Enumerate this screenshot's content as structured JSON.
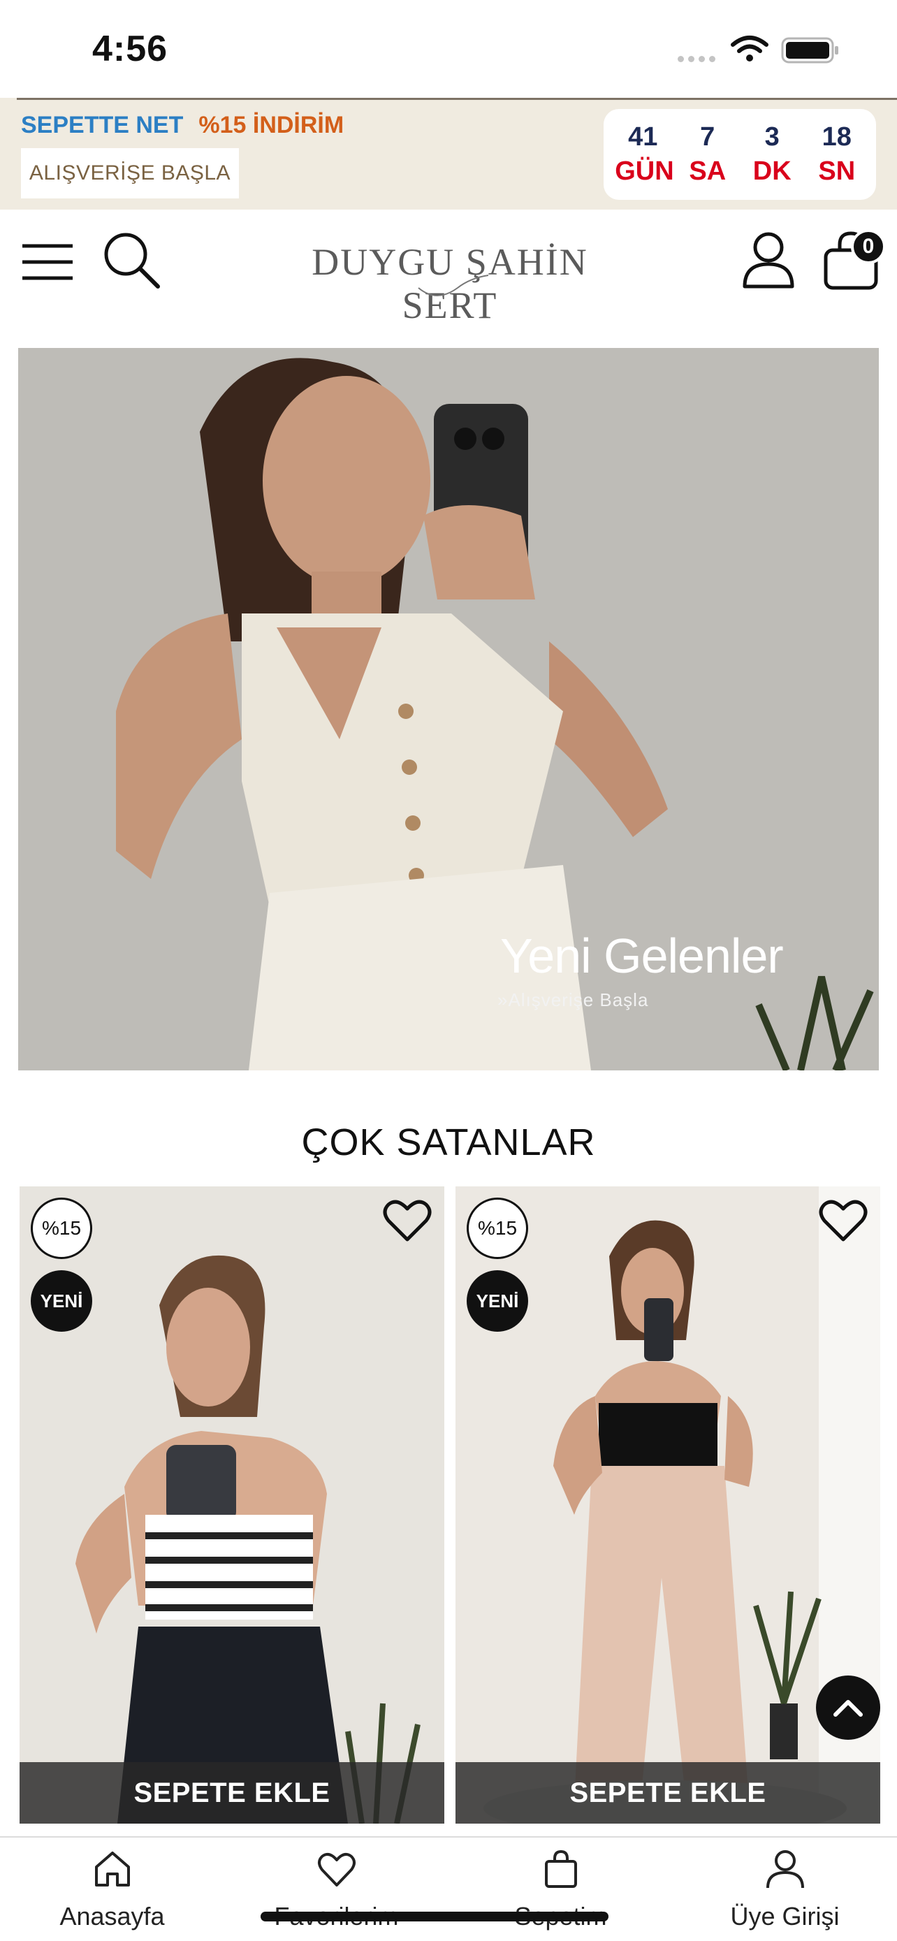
{
  "status_bar": {
    "time": "4:56"
  },
  "promo": {
    "label_blue": "SEPETTE NET",
    "label_orange": "%15 İNDİRİM",
    "cta": "ALIŞVERİŞE BAŞLA",
    "countdown": [
      {
        "value": "41",
        "unit": "GÜN"
      },
      {
        "value": "7",
        "unit": "SA"
      },
      {
        "value": "3",
        "unit": "DK"
      },
      {
        "value": "18",
        "unit": "SN"
      }
    ]
  },
  "header": {
    "brand": "DUYGU ŞAHİN SERT",
    "cart_count": "0"
  },
  "hero": {
    "title": "Yeni Gelenler",
    "subtitle": "»Alışverişe Başla"
  },
  "section": {
    "title": "ÇOK SATANLAR"
  },
  "products": [
    {
      "discount": "%15",
      "badge": "YENİ",
      "cta": "SEPETE EKLE"
    },
    {
      "discount": "%15",
      "badge": "YENİ",
      "cta": "SEPETE EKLE"
    }
  ],
  "tabbar": {
    "items": [
      {
        "label": "Anasayfa",
        "icon": "home-icon"
      },
      {
        "label": "Favorilerim",
        "icon": "heart-icon"
      },
      {
        "label": "Sepetim",
        "icon": "bag-icon"
      },
      {
        "label": "Üye Girişi",
        "icon": "user-icon"
      }
    ]
  },
  "colors": {
    "promo_bg": "#f0ebe0",
    "promo_blue": "#2c7fc4",
    "promo_orange": "#d35f1a",
    "countdown_red": "#d9001b",
    "countdown_navy": "#1c2a55"
  }
}
